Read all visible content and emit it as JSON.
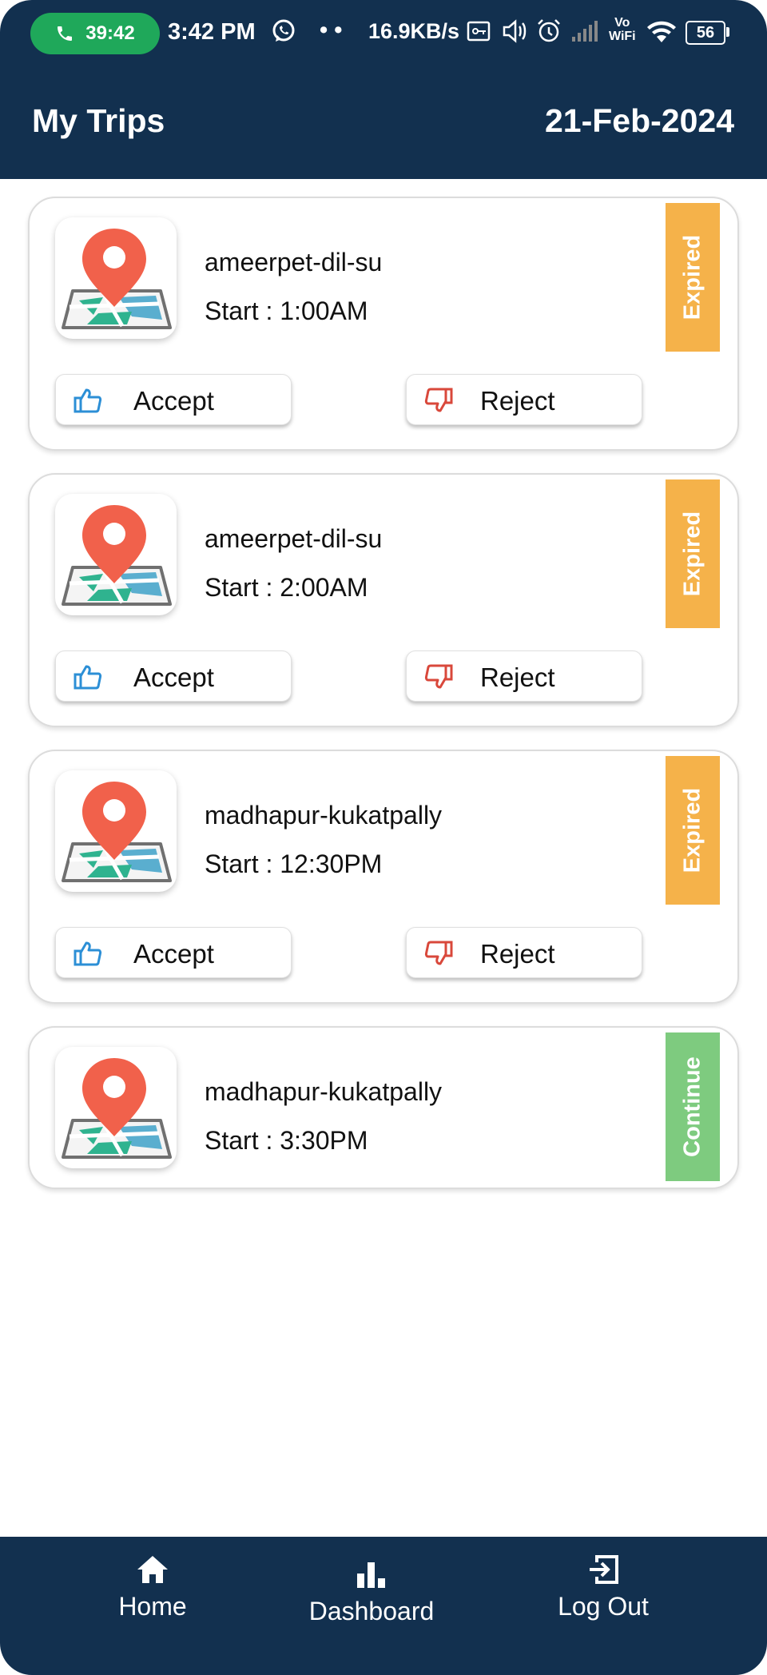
{
  "status_bar": {
    "call_timer": "39:42",
    "time": "3:42 PM",
    "dots": "• •",
    "net_speed": "16.9KB/s",
    "vowifi_top": "Vo",
    "vowifi_bottom": "WiFi",
    "battery": "56"
  },
  "header": {
    "title": "My Trips",
    "date": "21-Feb-2024"
  },
  "trips": [
    {
      "route": "ameerpet-dil-su",
      "start": "Start : 1:00AM",
      "status": "Expired",
      "accept_label": "Accept",
      "reject_label": "Reject"
    },
    {
      "route": "ameerpet-dil-su",
      "start": "Start : 2:00AM",
      "status": "Expired",
      "accept_label": "Accept",
      "reject_label": "Reject"
    },
    {
      "route": "madhapur-kukatpally",
      "start": "Start : 12:30PM",
      "status": "Expired",
      "accept_label": "Accept",
      "reject_label": "Reject"
    },
    {
      "route": "madhapur-kukatpally",
      "start": "Start : 3:30PM",
      "status": "Continue"
    }
  ],
  "bottom_nav": {
    "home": "Home",
    "dashboard": "Dashboard",
    "logout": "Log Out"
  },
  "colors": {
    "primary": "#12304f",
    "expired": "#f5b24a",
    "continue": "#7ecb7f",
    "accept_icon": "#2c8fd6",
    "reject_icon": "#d9483b",
    "call": "#1fa85a"
  }
}
